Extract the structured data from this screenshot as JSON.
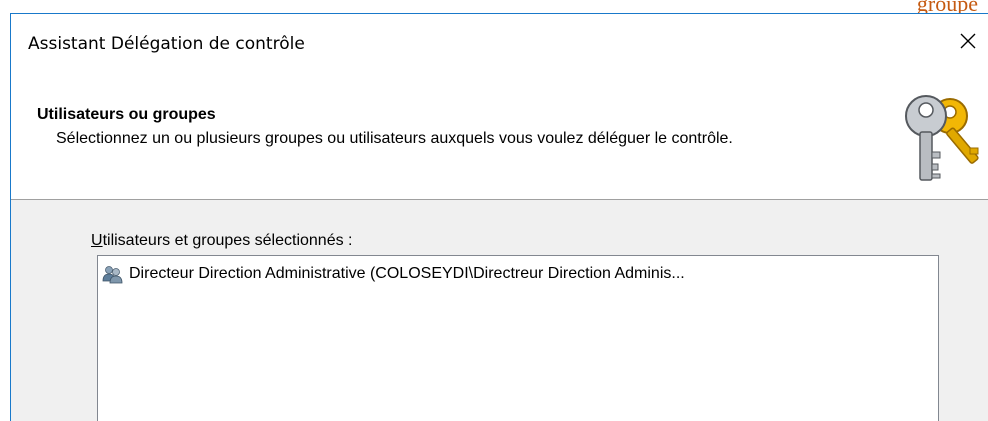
{
  "dialog": {
    "title": "Assistant Délégation de contrôle"
  },
  "header": {
    "title": "Utilisateurs ou groupes",
    "description": "Sélectionnez un ou plusieurs groupes ou utilisateurs auxquels vous voulez déléguer le contrôle."
  },
  "body": {
    "list_label_accel": "U",
    "list_label_rest": "tilisateurs et groupes sélectionnés :",
    "items": [
      {
        "label": "Directeur Direction Administrative (COLOSEYDI\\Directreur Direction Adminis..."
      }
    ]
  },
  "icons": {
    "close": "close-icon",
    "header": "keys-icon",
    "group": "group-icon"
  },
  "colors": {
    "window_border": "#1979ca",
    "panel_background": "#f0f0f0",
    "separator": "#a0a0a0",
    "background_text": "#c55a11"
  }
}
